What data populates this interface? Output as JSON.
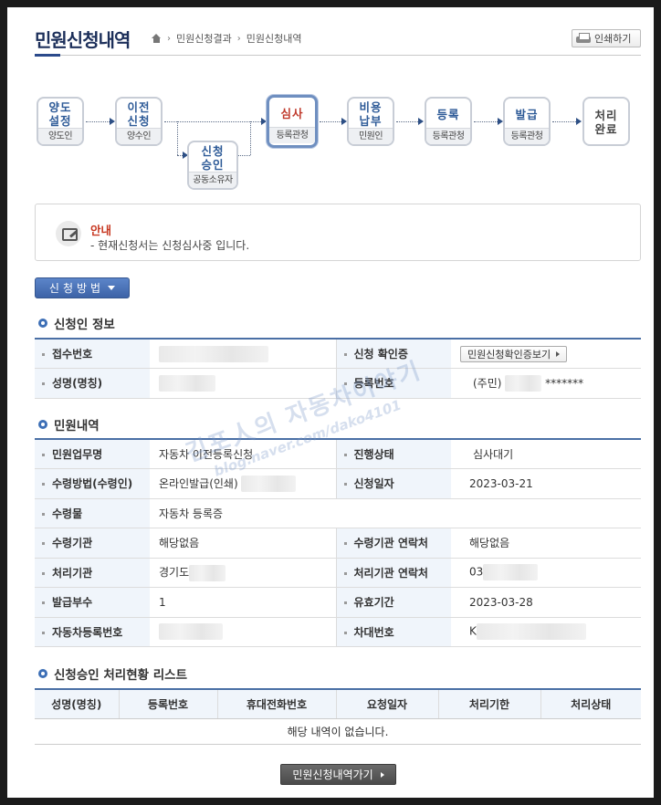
{
  "header": {
    "title": "민원신청내역",
    "breadcrumb": [
      "홈",
      "민원신청결과",
      "민원신청내역"
    ],
    "print_label": "인쇄하기"
  },
  "flow": {
    "steps": [
      {
        "name": "양도\n설정",
        "who": "양도인",
        "active": false
      },
      {
        "name": "이전\n신청",
        "who": "양수인",
        "active": false
      },
      {
        "name": "신청\n승인",
        "who": "공동소유자",
        "active": false
      },
      {
        "name": "심사",
        "who": "등록관청",
        "active": true
      },
      {
        "name": "비용\n납부",
        "who": "민원인",
        "active": false
      },
      {
        "name": "등록",
        "who": "등록관청",
        "active": false
      },
      {
        "name": "발급",
        "who": "등록관청",
        "active": false
      },
      {
        "name": "처리\n완료",
        "who": "",
        "active": false
      }
    ]
  },
  "notice": {
    "title": "안내",
    "text": "- 현재신청서는 신청심사중 입니다."
  },
  "method_button": "신청방법",
  "applicant": {
    "heading": "신청인 정보",
    "receipt_no_label": "접수번호",
    "confirm_label": "신청 확인증",
    "confirm_button": "민원신청확인증보기",
    "name_label": "성명(명칭)",
    "reg_no_label": "등록번호",
    "reg_no_prefix": "(주민)",
    "reg_no_masked": "*******"
  },
  "civil": {
    "heading": "민원내역",
    "rows": [
      {
        "l1": "민원업무명",
        "v1": "자동차 이전등록신청",
        "l2": "진행상태",
        "v2": "심사대기"
      },
      {
        "l1": "수령방법(수령인)",
        "v1": "온라인발급(인쇄)",
        "l2": "신청일자",
        "v2": "2023-03-21"
      },
      {
        "l1": "수령물",
        "v1": "자동차 등록증"
      },
      {
        "l1": "수령기관",
        "v1": "해당없음",
        "l2": "수령기관 연락처",
        "v2": "해당없음"
      },
      {
        "l1": "처리기관",
        "v1": "경기도",
        "l2": "처리기관 연락처",
        "v2": "03"
      },
      {
        "l1": "발급부수",
        "v1": "1",
        "l2": "유효기간",
        "v2": "2023-03-28"
      },
      {
        "l1": "자동차등록번호",
        "v1": "",
        "l2": "차대번호",
        "v2": "K"
      }
    ]
  },
  "approval": {
    "heading": "신청승인 처리현황 리스트",
    "columns": [
      "성명(명칭)",
      "등록번호",
      "휴대전화번호",
      "요청일자",
      "처리기한",
      "처리상태"
    ],
    "empty": "해당 내역이 없습니다."
  },
  "bottom_button": "민원신청내역가기",
  "watermark": {
    "line1": "김포人의 자동차이야기",
    "line2": "blog.naver.com/dako4101"
  },
  "colors": {
    "accent": "#3d63a7",
    "active_step": "#c0392b",
    "notice_title": "#c7361f"
  }
}
